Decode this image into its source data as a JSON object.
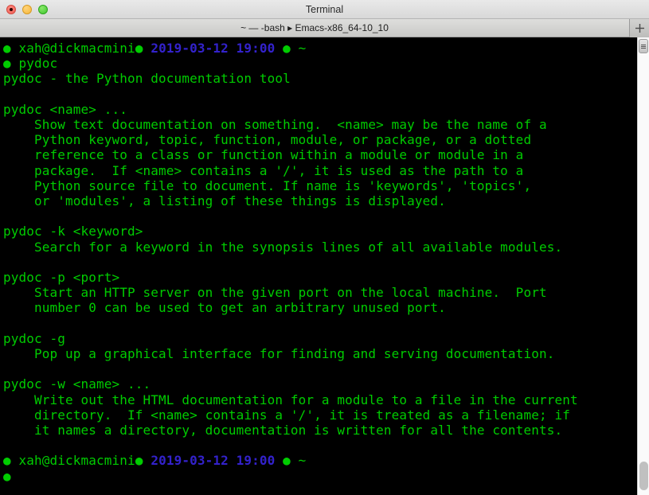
{
  "window": {
    "title": "Terminal",
    "traffic_lights": [
      "close",
      "minimize",
      "maximize"
    ]
  },
  "tabbar": {
    "tab_title": "~ — -bash ▸ Emacs-x86_64-10_10",
    "new_tab_label": "+"
  },
  "colors": {
    "terminal_background": "#000000",
    "text_green": "#00cc00",
    "text_blue": "#3322cc",
    "chrome_gray": "#d8d8d8"
  },
  "terminal": {
    "prompt": {
      "user_host": "xah@dickmacmini",
      "date": "2019-03-12",
      "time": "19:00",
      "cwd": "~",
      "bullet": "●"
    },
    "command": "pydoc",
    "lines": [
      {
        "id": "prompt-1",
        "type": "prompt"
      },
      {
        "id": "command-1",
        "type": "command",
        "text": "pydoc"
      },
      {
        "id": "out-1",
        "type": "output",
        "text": "pydoc - the Python documentation tool"
      },
      {
        "id": "out-2",
        "type": "output",
        "text": ""
      },
      {
        "id": "out-3",
        "type": "output",
        "text": "pydoc <name> ..."
      },
      {
        "id": "out-4",
        "type": "output",
        "text": "    Show text documentation on something.  <name> may be the name of a"
      },
      {
        "id": "out-5",
        "type": "output",
        "text": "    Python keyword, topic, function, module, or package, or a dotted"
      },
      {
        "id": "out-6",
        "type": "output",
        "text": "    reference to a class or function within a module or module in a"
      },
      {
        "id": "out-7",
        "type": "output",
        "text": "    package.  If <name> contains a '/', it is used as the path to a"
      },
      {
        "id": "out-8",
        "type": "output",
        "text": "    Python source file to document. If name is 'keywords', 'topics',"
      },
      {
        "id": "out-9",
        "type": "output",
        "text": "    or 'modules', a listing of these things is displayed."
      },
      {
        "id": "out-10",
        "type": "output",
        "text": ""
      },
      {
        "id": "out-11",
        "type": "output",
        "text": "pydoc -k <keyword>"
      },
      {
        "id": "out-12",
        "type": "output",
        "text": "    Search for a keyword in the synopsis lines of all available modules."
      },
      {
        "id": "out-13",
        "type": "output",
        "text": ""
      },
      {
        "id": "out-14",
        "type": "output",
        "text": "pydoc -p <port>"
      },
      {
        "id": "out-15",
        "type": "output",
        "text": "    Start an HTTP server on the given port on the local machine.  Port"
      },
      {
        "id": "out-16",
        "type": "output",
        "text": "    number 0 can be used to get an arbitrary unused port."
      },
      {
        "id": "out-17",
        "type": "output",
        "text": ""
      },
      {
        "id": "out-18",
        "type": "output",
        "text": "pydoc -g"
      },
      {
        "id": "out-19",
        "type": "output",
        "text": "    Pop up a graphical interface for finding and serving documentation."
      },
      {
        "id": "out-20",
        "type": "output",
        "text": ""
      },
      {
        "id": "out-21",
        "type": "output",
        "text": "pydoc -w <name> ..."
      },
      {
        "id": "out-22",
        "type": "output",
        "text": "    Write out the HTML documentation for a module to a file in the current"
      },
      {
        "id": "out-23",
        "type": "output",
        "text": "    directory.  If <name> contains a '/', it is treated as a filename; if"
      },
      {
        "id": "out-24",
        "type": "output",
        "text": "    it names a directory, documentation is written for all the contents."
      },
      {
        "id": "out-25",
        "type": "output",
        "text": ""
      },
      {
        "id": "prompt-2",
        "type": "prompt"
      },
      {
        "id": "cursor-line",
        "type": "cursor"
      }
    ]
  },
  "scrollbar": {
    "thumb_top_position": "top",
    "thumb_bottom_position": "bottom"
  }
}
